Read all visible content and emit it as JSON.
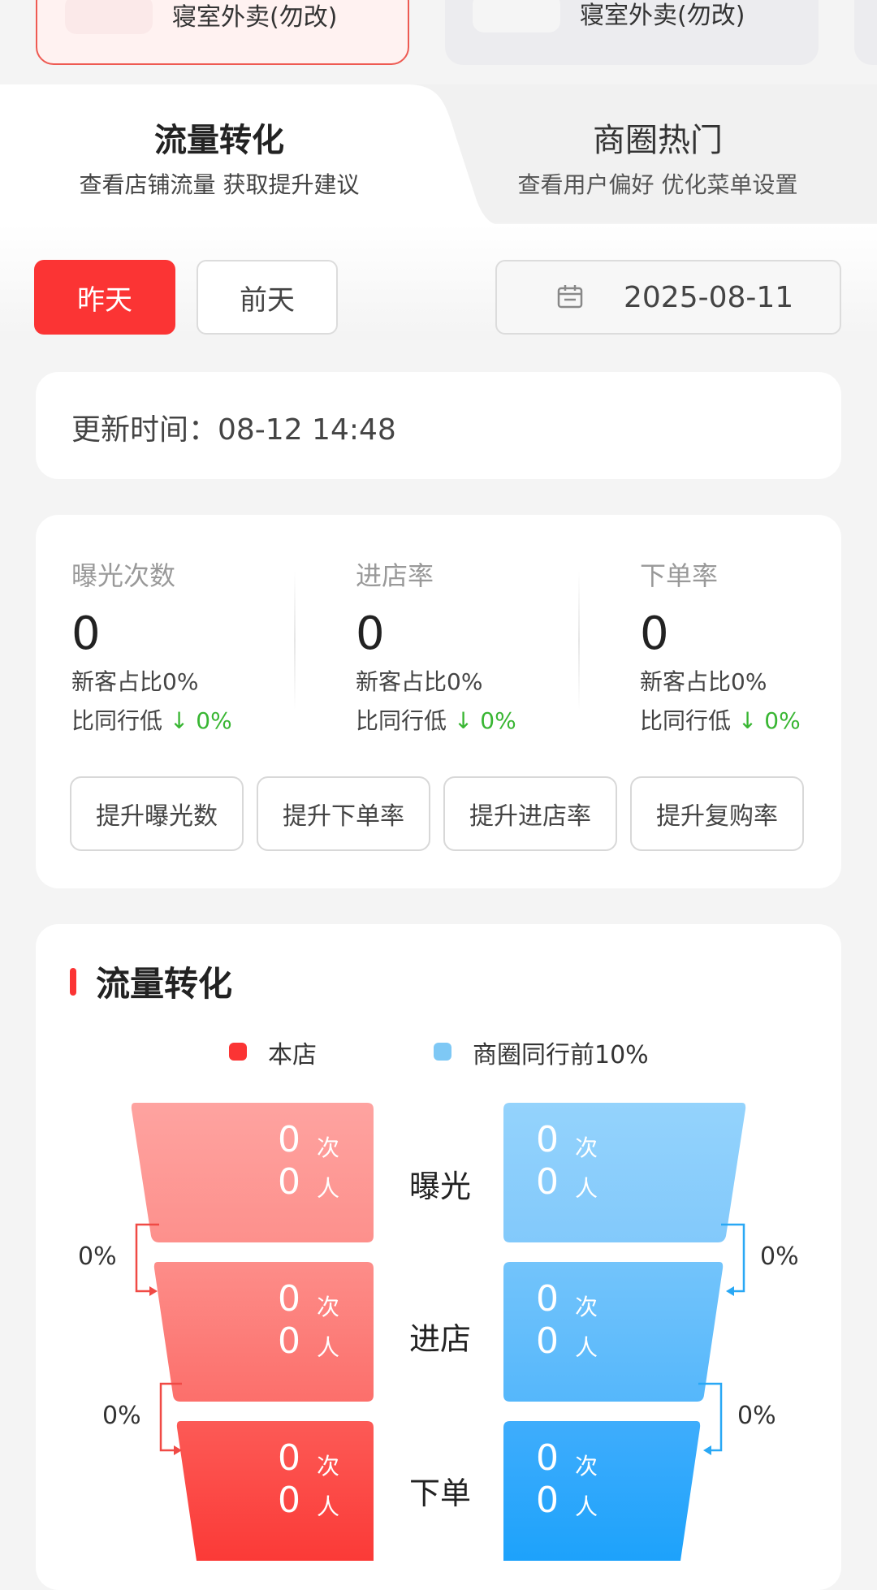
{
  "stores": [
    {
      "name": "寝室外卖(勿改)"
    },
    {
      "name": "寝室外卖(勿改)"
    }
  ],
  "tabs": [
    {
      "title": "流量转化",
      "subtitle": "查看店铺流量 获取提升建议"
    },
    {
      "title": "商圈热门",
      "subtitle": "查看用户偏好 优化菜单设置"
    }
  ],
  "date_filter": {
    "yesterday": "昨天",
    "day_before": "前天",
    "date": "2025-08-11"
  },
  "update": {
    "text": "更新时间：08-12 14:48"
  },
  "metrics": [
    {
      "label": "曝光次数",
      "value": "0",
      "new_ratio": "新客占比0%",
      "compare_label": "比同行低",
      "compare_value": "↓ 0%"
    },
    {
      "label": "进店率",
      "value": "0",
      "new_ratio": "新客占比0%",
      "compare_label": "比同行低",
      "compare_value": "↓ 0%"
    },
    {
      "label": "下单率",
      "value": "0",
      "new_ratio": "新客占比0%",
      "compare_label": "比同行低",
      "compare_value": "↓ 0%"
    }
  ],
  "actions": [
    "提升曝光数",
    "提升下单率",
    "提升进店率",
    "提升复购率"
  ],
  "funnel": {
    "title": "流量转化",
    "legend": [
      {
        "name": "本店",
        "color": "#fb3434"
      },
      {
        "name": "商圈同行前10%",
        "color": "#7ec8f5"
      }
    ],
    "stages": [
      {
        "label": "曝光",
        "store_times": "0",
        "store_people": "0",
        "peer_times": "0",
        "peer_people": "0"
      },
      {
        "label": "进店",
        "store_times": "0",
        "store_people": "0",
        "peer_times": "0",
        "peer_people": "0"
      },
      {
        "label": "下单",
        "store_times": "0",
        "store_people": "0",
        "peer_times": "0",
        "peer_people": "0"
      }
    ],
    "unit_times": "次",
    "unit_people": "人",
    "store_rates": [
      "0%",
      "0%"
    ],
    "peer_rates": [
      "0%",
      "0%"
    ]
  }
}
